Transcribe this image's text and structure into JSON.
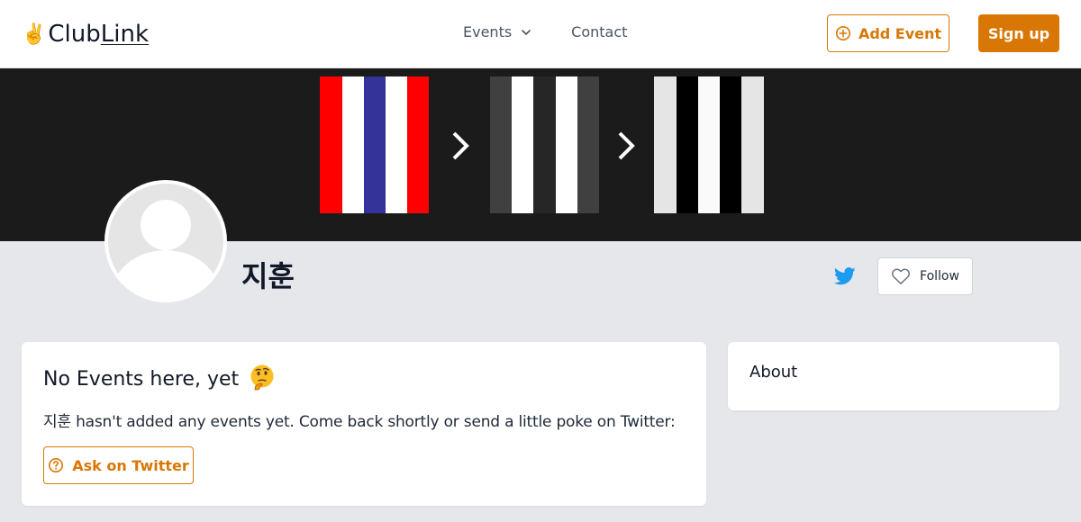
{
  "header": {
    "logo_text_1": "Club",
    "logo_text_2": "Link",
    "logo_emoji": "✌️",
    "nav": {
      "events_label": "Events",
      "contact_label": "Contact"
    },
    "add_event_label": "Add Event",
    "signup_label": "Sign up"
  },
  "profile": {
    "name": "지훈",
    "follow_label": "Follow",
    "twitter_icon": "twitter-icon"
  },
  "events": {
    "title": "No Events here, yet",
    "emoji": "🤔",
    "description": "지훈 hasn't added any events yet. Come back shortly or send a little poke on Twitter:",
    "ask_label": "Ask on Twitter"
  },
  "about": {
    "title": "About"
  },
  "colors": {
    "accent": "#d97706",
    "twitter": "#1d9bf0",
    "page_bg": "#e5e7eb",
    "banner_bg": "#1b1b1b",
    "flag_red": "#ff0000",
    "flag_blue": "#333399"
  }
}
